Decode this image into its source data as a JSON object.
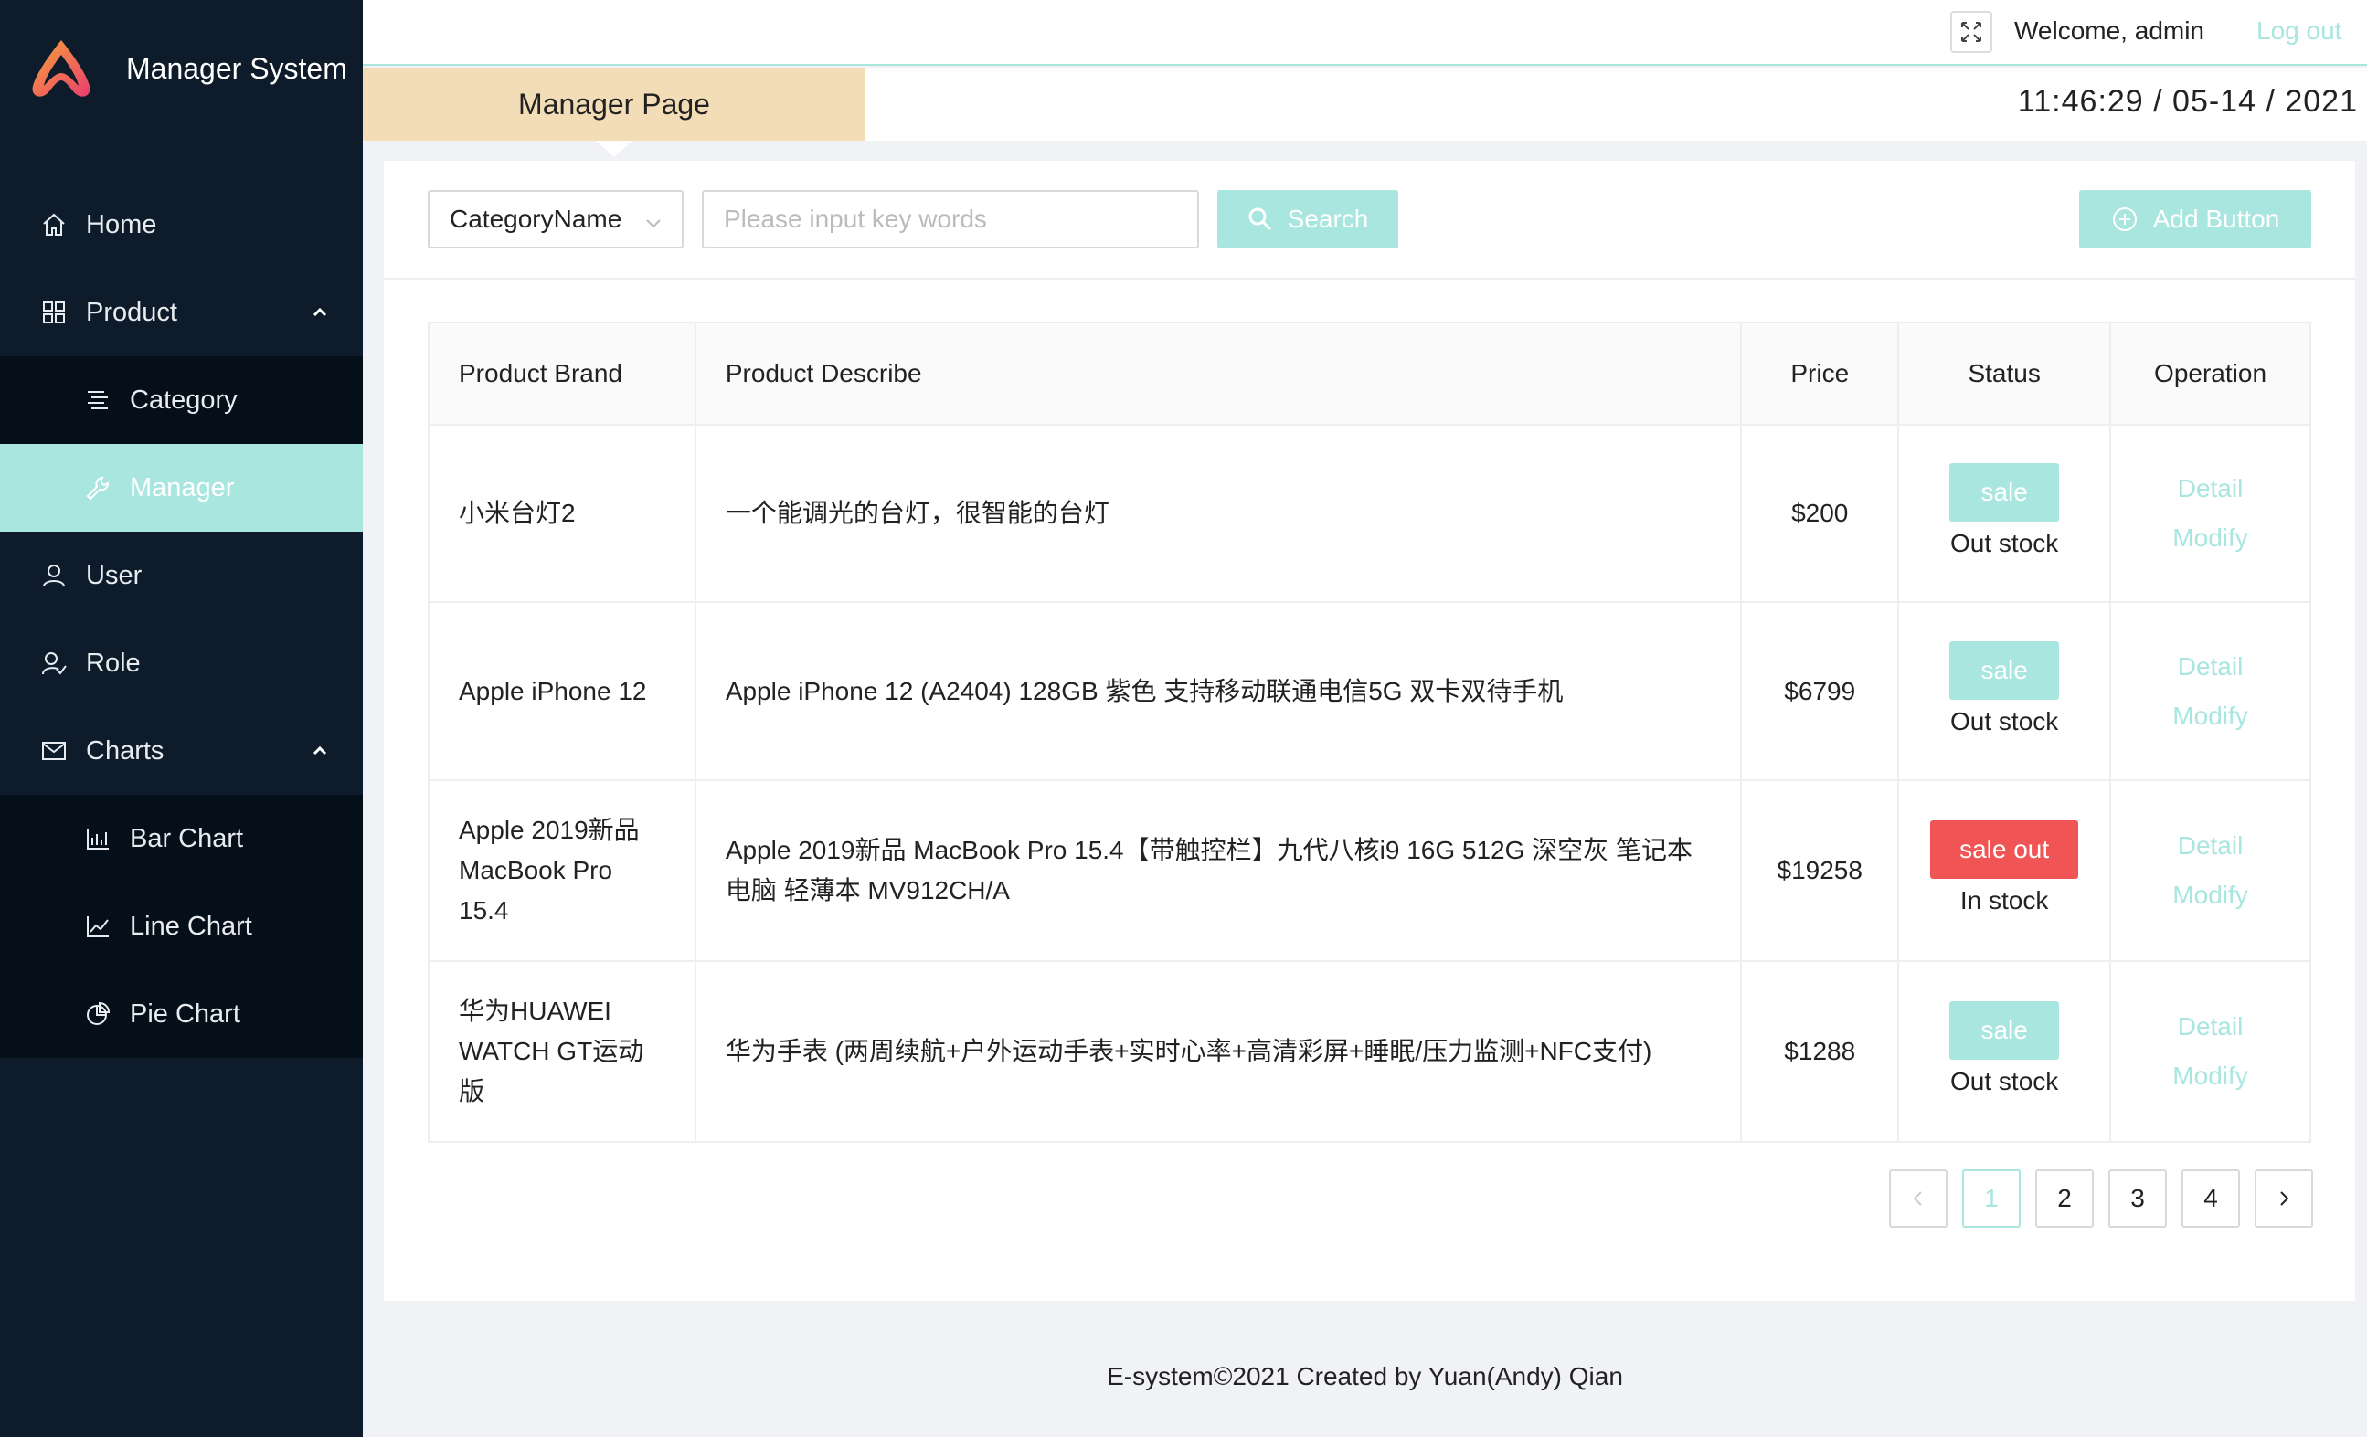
{
  "app": {
    "title": "Manager System"
  },
  "sidebar": {
    "items": [
      {
        "label": "Home",
        "icon": "home-icon"
      },
      {
        "label": "Product",
        "icon": "grid-icon",
        "expanded": true
      },
      {
        "label": "Category",
        "icon": "list-icon"
      },
      {
        "label": "Manager",
        "icon": "wrench-icon",
        "active": true
      },
      {
        "label": "User",
        "icon": "user-icon"
      },
      {
        "label": "Role",
        "icon": "role-icon"
      },
      {
        "label": "Charts",
        "icon": "mail-icon",
        "expanded": true
      },
      {
        "label": "Bar Chart",
        "icon": "bar-chart-icon"
      },
      {
        "label": "Line Chart",
        "icon": "line-chart-icon"
      },
      {
        "label": "Pie Chart",
        "icon": "pie-chart-icon"
      }
    ]
  },
  "header": {
    "welcome": "Welcome, admin",
    "logout": "Log out"
  },
  "subheader": {
    "page_title": "Manager Page",
    "clock": "11:46:29 / 05-14 / 2021"
  },
  "toolbar": {
    "select_value": "CategoryName",
    "search_placeholder": "Please input key words",
    "search_label": "Search",
    "add_label": "Add Button"
  },
  "table": {
    "headers": [
      "Product Brand",
      "Product Describe",
      "Price",
      "Status",
      "Operation"
    ],
    "rows": [
      {
        "brand": "小米台灯2",
        "desc": "一个能调光的台灯，很智能的台灯",
        "price": "$200",
        "badge": "sale",
        "stock": "Out stock"
      },
      {
        "brand": "Apple iPhone 12",
        "desc": "Apple iPhone 12 (A2404) 128GB 紫色 支持移动联通电信5G 双卡双待手机",
        "price": "$6799",
        "badge": "sale",
        "stock": "Out stock"
      },
      {
        "brand": "Apple 2019新品 MacBook Pro 15.4",
        "desc": "Apple 2019新品 MacBook Pro 15.4【带触控栏】九代八核i9 16G 512G 深空灰 笔记本电脑 轻薄本 MV912CH/A",
        "price": "$19258",
        "badge": "sale out",
        "stock": "In stock"
      },
      {
        "brand": "华为HUAWEI WATCH GT运动版",
        "desc": "华为手表 (两周续航+户外运动手表+实时心率+高清彩屏+睡眠/压力监测+NFC支付)",
        "price": "$1288",
        "badge": "sale",
        "stock": "Out stock"
      }
    ],
    "op_detail": "Detail",
    "op_modify": "Modify"
  },
  "pagination": {
    "pages": [
      "1",
      "2",
      "3",
      "4"
    ],
    "current": "1"
  },
  "footer": {
    "text": "E-system©2021 Created by Yuan(Andy) Qian"
  },
  "colors": {
    "accent": "#a8e6df",
    "sidebar_bg": "#0d1b2a",
    "tab_bg": "#f2ddb6",
    "danger": "#f05454"
  }
}
